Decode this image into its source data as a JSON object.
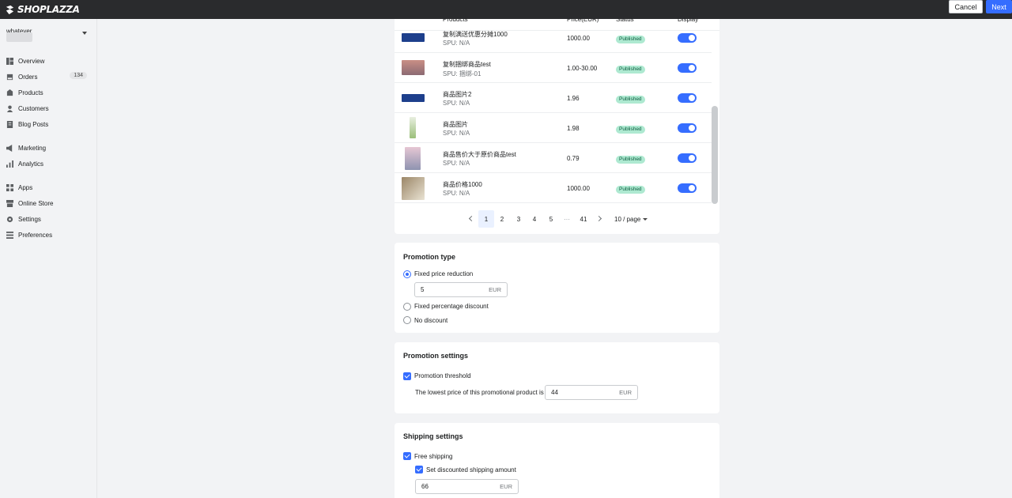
{
  "app": {
    "logo_text": "SHOPLAZZA"
  },
  "header": {
    "cancel_label": "Cancel",
    "next_label": "Next"
  },
  "sidebar": {
    "store_name": "whatever",
    "items": [
      {
        "label": "Overview",
        "icon": "overview-icon"
      },
      {
        "label": "Orders",
        "icon": "orders-icon",
        "badge": "134"
      },
      {
        "label": "Products",
        "icon": "products-icon"
      },
      {
        "label": "Customers",
        "icon": "customers-icon"
      },
      {
        "label": "Blog Posts",
        "icon": "blog-icon"
      },
      {
        "label": "Marketing",
        "icon": "marketing-icon"
      },
      {
        "label": "Analytics",
        "icon": "analytics-icon"
      },
      {
        "label": "Apps",
        "icon": "apps-icon"
      },
      {
        "label": "Online Store",
        "icon": "store-icon"
      },
      {
        "label": "Settings",
        "icon": "gear-icon"
      },
      {
        "label": "Preferences",
        "icon": "preferences-icon"
      }
    ]
  },
  "products_table": {
    "columns": [
      "Products",
      "Price(EUR)",
      "Status",
      "Display"
    ],
    "rows": [
      {
        "name": "复制满送优惠分摊1000",
        "spu": "SPU: N/A",
        "price": "1000.00",
        "status": "Published"
      },
      {
        "name": "复制捆绑商品test",
        "spu": "SPU: 捆绑-01",
        "price": "1.00-30.00",
        "status": "Published"
      },
      {
        "name": "商品图片2",
        "spu": "SPU: N/A",
        "price": "1.96",
        "status": "Published"
      },
      {
        "name": "商品图片",
        "spu": "SPU: N/A",
        "price": "1.98",
        "status": "Published"
      },
      {
        "name": "商品售价大于原价商品test",
        "spu": "SPU: N/A",
        "price": "0.79",
        "status": "Published"
      },
      {
        "name": "商品价格1000",
        "spu": "SPU: N/A",
        "price": "1000.00",
        "status": "Published"
      }
    ],
    "pagination": {
      "pages": [
        "1",
        "2",
        "3",
        "4",
        "5",
        "···",
        "41"
      ],
      "current": "1",
      "page_size": "10 / page"
    }
  },
  "promotion_type": {
    "title": "Promotion type",
    "options": [
      "Fixed price reduction",
      "Fixed percentage discount",
      "No discount"
    ],
    "selected": "Fixed price reduction",
    "amount": "5",
    "unit": "EUR"
  },
  "promotion_settings": {
    "title": "Promotion settings",
    "threshold_label": "Promotion threshold",
    "lowest_price_label": "The lowest price of this promotional product is",
    "lowest_price_value": "44",
    "unit": "EUR"
  },
  "shipping_settings": {
    "title": "Shipping settings",
    "free_shipping_label": "Free shipping",
    "discounted_label": "Set discounted shipping amount",
    "amount": "66",
    "unit": "EUR"
  },
  "colors": {
    "accent": "#356dff",
    "topbar": "#2a2b2d",
    "badge_bg": "#aee9d1"
  }
}
